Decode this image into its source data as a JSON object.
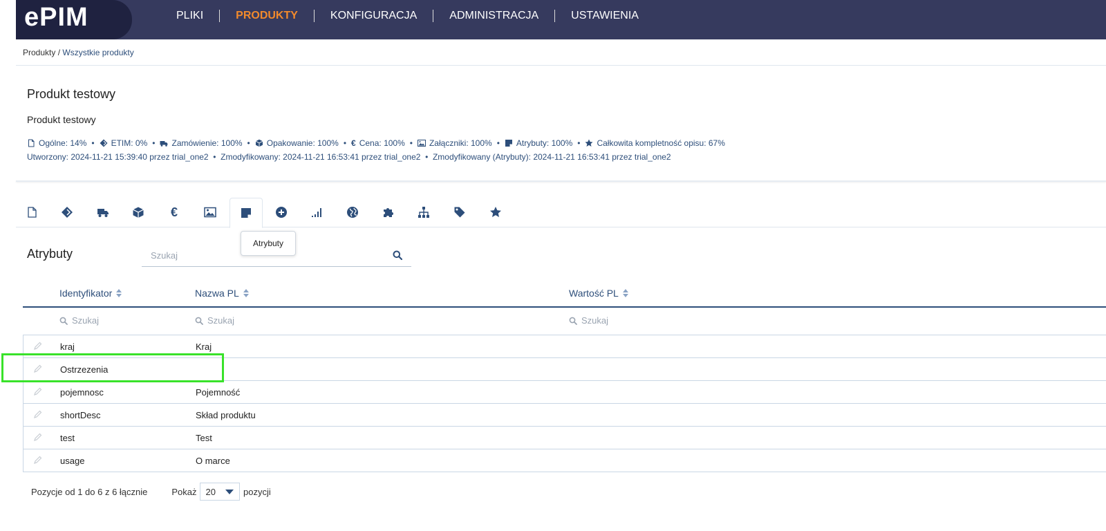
{
  "logo": {
    "text": "PIM",
    "brand_prefix": "e"
  },
  "nav": {
    "items": [
      {
        "label": "PLIKI"
      },
      {
        "label": "PRODUKTY"
      },
      {
        "label": "KONFIGURACJA"
      },
      {
        "label": "ADMINISTRACJA"
      },
      {
        "label": "USTAWIENIA"
      }
    ],
    "active": "PRODUKTY",
    "active_color": "#f28a2c"
  },
  "breadcrumb": {
    "root": "Produkty",
    "separator": " / ",
    "current": "Wszystkie produkty"
  },
  "product": {
    "title": "Produkt testowy",
    "subtitle": "Produkt testowy",
    "stats": [
      {
        "icon": "document-icon",
        "text": "Ogólne: 14%"
      },
      {
        "icon": "etim-icon",
        "text": "ETIM: 0%"
      },
      {
        "icon": "truck-icon",
        "text": "Zamówienie: 100%"
      },
      {
        "icon": "box-icon",
        "text": "Opakowanie: 100%"
      },
      {
        "icon": "euro-icon",
        "text": "Cena: 100%"
      },
      {
        "icon": "image-icon",
        "text": "Załączniki: 100%"
      },
      {
        "icon": "note-icon",
        "text": "Atrybuty: 100%"
      },
      {
        "icon": "star-icon",
        "text": "Całkowita kompletność opisu: 67%"
      }
    ],
    "meta": "Utworzony: 2024-11-21 15:39:40 przez trial_one2  •  Zmodyfikowany: 2024-11-21 16:53:41 przez trial_one2  •  Zmodyfikowany (Atrybuty): 2024-11-21 16:53:41 przez trial_one2"
  },
  "tabs": {
    "icons": [
      "document-icon",
      "etim-icon",
      "truck-icon",
      "box-icon",
      "euro-icon",
      "image-icon",
      "note-icon",
      "plus-circle-icon",
      "signal-icon",
      "globe-icon",
      "puzzle-icon",
      "sitemap-icon",
      "tag-icon",
      "star-icon"
    ],
    "active": "note-icon",
    "tooltip": "Atrybuty"
  },
  "section": {
    "title": "Atrybuty",
    "search_placeholder": "Szukaj"
  },
  "table": {
    "columns": [
      "Identyfikator",
      "Nazwa PL",
      "Wartość PL"
    ],
    "filter_placeholder": "Szukaj",
    "rows": [
      {
        "id": "kraj",
        "name": "Kraj",
        "value": ""
      },
      {
        "id": "Ostrzezenia",
        "name": "",
        "value": ""
      },
      {
        "id": "pojemnosc",
        "name": "Pojemność",
        "value": ""
      },
      {
        "id": "shortDesc",
        "name": "Skład produktu",
        "value": ""
      },
      {
        "id": "test",
        "name": "Test",
        "value": ""
      },
      {
        "id": "usage",
        "name": "O marce",
        "value": ""
      }
    ]
  },
  "footer": {
    "page_info": "Pozycje od 1 do 6 z 6 łącznie",
    "show_label": "Pokaż",
    "page_size": "20",
    "suffix": "pozycji"
  },
  "colors": {
    "nav_bg": "#363a5e",
    "link": "#2d4e7a",
    "highlight": "#39e22a"
  }
}
